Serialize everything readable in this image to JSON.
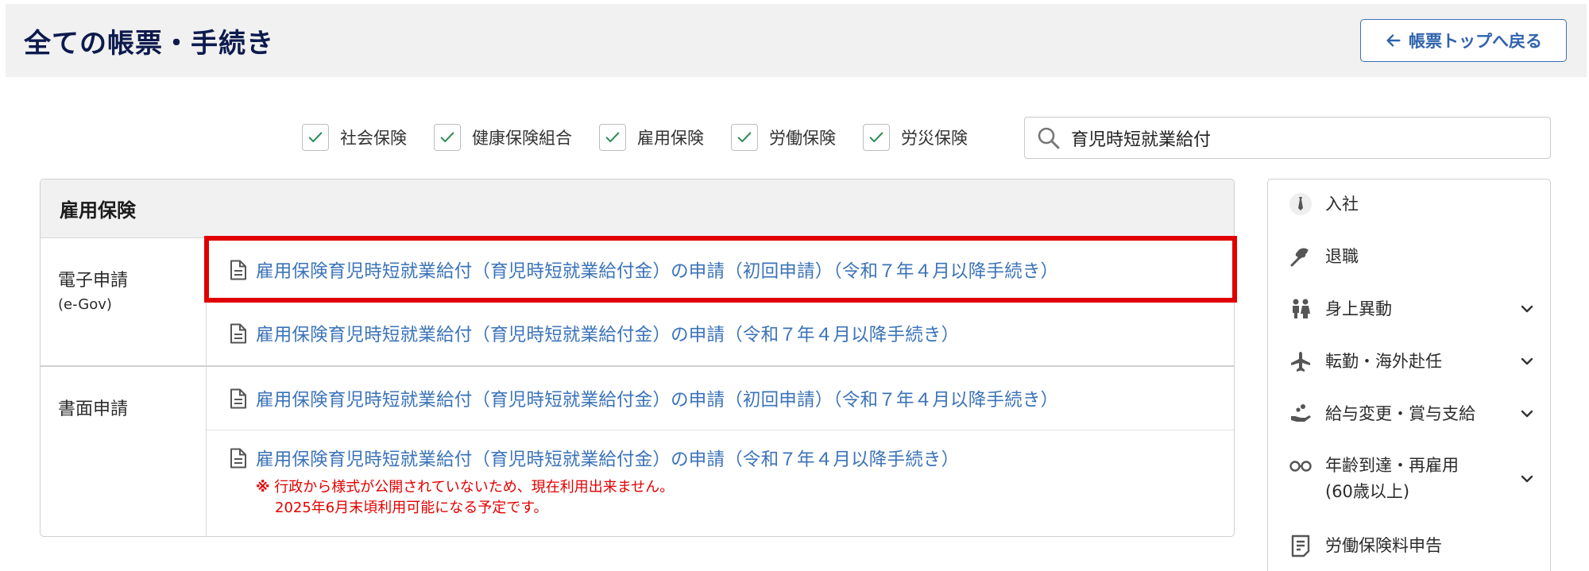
{
  "header": {
    "title": "全ての帳票・手続き",
    "back_button": "帳票トップへ戻る"
  },
  "filters": [
    {
      "label": "社会保険",
      "checked": true
    },
    {
      "label": "健康保険組合",
      "checked": true
    },
    {
      "label": "雇用保険",
      "checked": true
    },
    {
      "label": "労働保険",
      "checked": true
    },
    {
      "label": "労災保険",
      "checked": true
    }
  ],
  "search": {
    "value": "育児時短就業給付"
  },
  "main": {
    "section_title": "雇用保険",
    "groups": [
      {
        "label": "電子申請",
        "sublabel": "(e-Gov)",
        "links": [
          "雇用保険育児時短就業給付（育児時短就業給付金）の申請（初回申請）（令和７年４月以降手続き）",
          "雇用保険育児時短就業給付（育児時短就業給付金）の申請（令和７年４月以降手続き）"
        ]
      },
      {
        "label": "書面申請",
        "links": [
          "雇用保険育児時短就業給付（育児時短就業給付金）の申請（初回申請）（令和７年４月以降手続き）",
          "雇用保険育児時短就業給付（育児時短就業給付金）の申請（令和７年４月以降手続き）"
        ],
        "note": {
          "mark": "※",
          "line1": "行政から様式が公開されていないため、現在利用出来ません。",
          "line2": "2025年6月末頃利用可能になる予定です。"
        }
      }
    ]
  },
  "sidebar": {
    "items": [
      {
        "label": "入社",
        "icon": "necktie-icon",
        "expandable": false
      },
      {
        "label": "退職",
        "icon": "bouquet-icon",
        "expandable": false
      },
      {
        "label": "身上異動",
        "icon": "couple-icon",
        "expandable": true
      },
      {
        "label": "転勤・海外赴任",
        "icon": "airplane-icon",
        "expandable": true
      },
      {
        "label": "給与変更・賞与支給",
        "icon": "coin-hand-icon",
        "expandable": true
      },
      {
        "label": "年齢到達・再雇用",
        "label2": "(60歳以上)",
        "icon": "glasses-icon",
        "expandable": true
      },
      {
        "label": "労働保険料申告",
        "icon": "document-list-icon",
        "expandable": false
      }
    ]
  },
  "colors": {
    "title": "#0d1a4d",
    "link": "#3b73b9",
    "highlight": "#e00000",
    "note": "#e30000",
    "check": "#2e8b57"
  }
}
